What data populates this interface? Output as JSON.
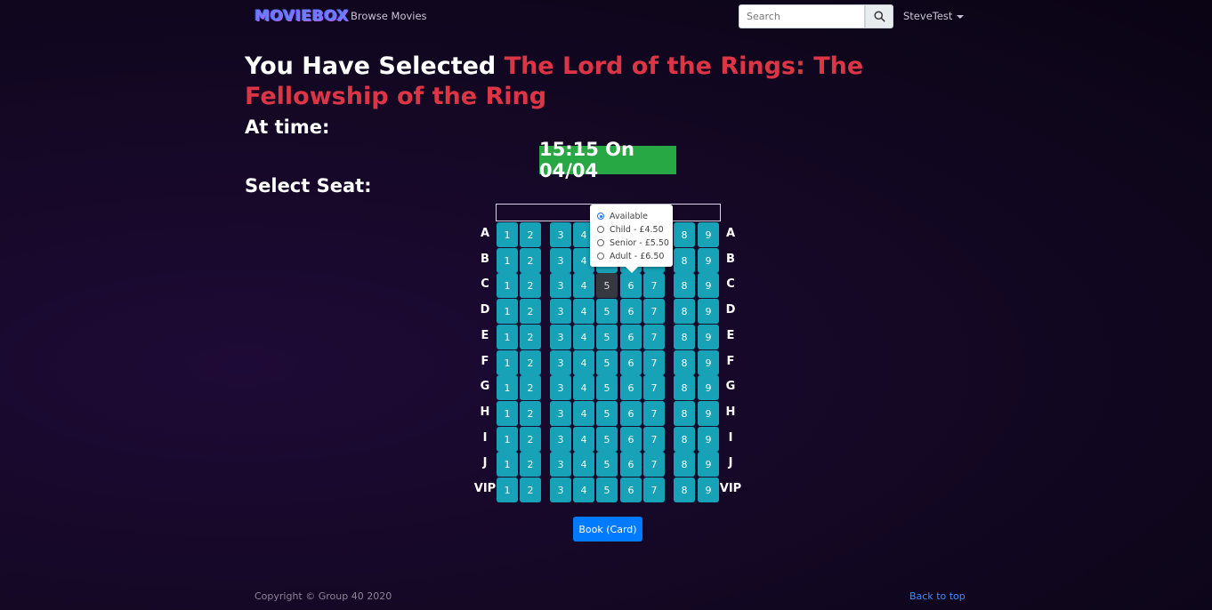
{
  "navbar": {
    "brand": "MOVIEBOX",
    "browse_label": "Browse Movies",
    "search_placeholder": "Search",
    "user_label": "SteveTest"
  },
  "heading": {
    "prefix": "You Have Selected",
    "movie_title": "The Lord of the Rings: The Fellowship of the Ring"
  },
  "showtime": {
    "label": "At time:",
    "value": "15:15 On 04/04"
  },
  "seating": {
    "label": "Select Seat:",
    "rows": [
      "A",
      "B",
      "C",
      "D",
      "E",
      "F",
      "G",
      "H",
      "I",
      "J",
      "VIP"
    ],
    "seat_numbers": [
      "1",
      "2",
      "3",
      "4",
      "5",
      "6",
      "7",
      "8",
      "9"
    ],
    "selected_seat": "C5",
    "popover_seat": "B6",
    "colors": {
      "available": "#17a2b8",
      "selected": "#343a40"
    }
  },
  "ticket_options": [
    {
      "label": "Available",
      "checked": true
    },
    {
      "label": "Child - £4.50",
      "checked": false
    },
    {
      "label": "Senior - £5.50",
      "checked": false
    },
    {
      "label": "Adult - £6.50",
      "checked": false
    }
  ],
  "book_button": "Book (Card)",
  "footer": {
    "copyright": "Copyright © Group 40 2020",
    "back_to_top": "Back to top"
  }
}
